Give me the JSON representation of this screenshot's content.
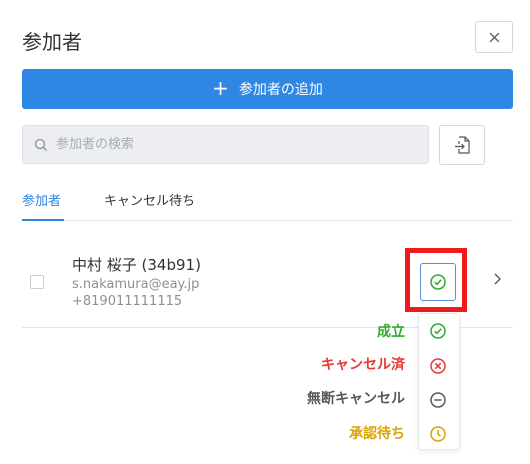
{
  "dialog": {
    "title": "参加者",
    "close_label": "×"
  },
  "add_button": {
    "label": "参加者の追加"
  },
  "search": {
    "placeholder": "参加者の検索",
    "value": ""
  },
  "tabs": [
    {
      "label": "参加者",
      "active": true
    },
    {
      "label": "キャンセル待ち",
      "active": false
    }
  ],
  "participant": {
    "name": "中村 桜子 (34b91)",
    "email": "s.nakamura@eay.jp",
    "phone": "+819011111115",
    "status": "成立"
  },
  "status_menu": {
    "items": [
      {
        "label": "成立",
        "icon": "check-circle-icon",
        "color": "#2eaa2e"
      },
      {
        "label": "キャンセル済",
        "icon": "x-circle-icon",
        "color": "#e53935"
      },
      {
        "label": "無断キャンセル",
        "icon": "minus-circle-icon",
        "color": "#555a60"
      },
      {
        "label": "承認待ち",
        "icon": "clock-icon",
        "color": "#d9a300"
      }
    ]
  },
  "colors": {
    "accent": "#2e86e5",
    "highlight": "#ef1b1b"
  }
}
